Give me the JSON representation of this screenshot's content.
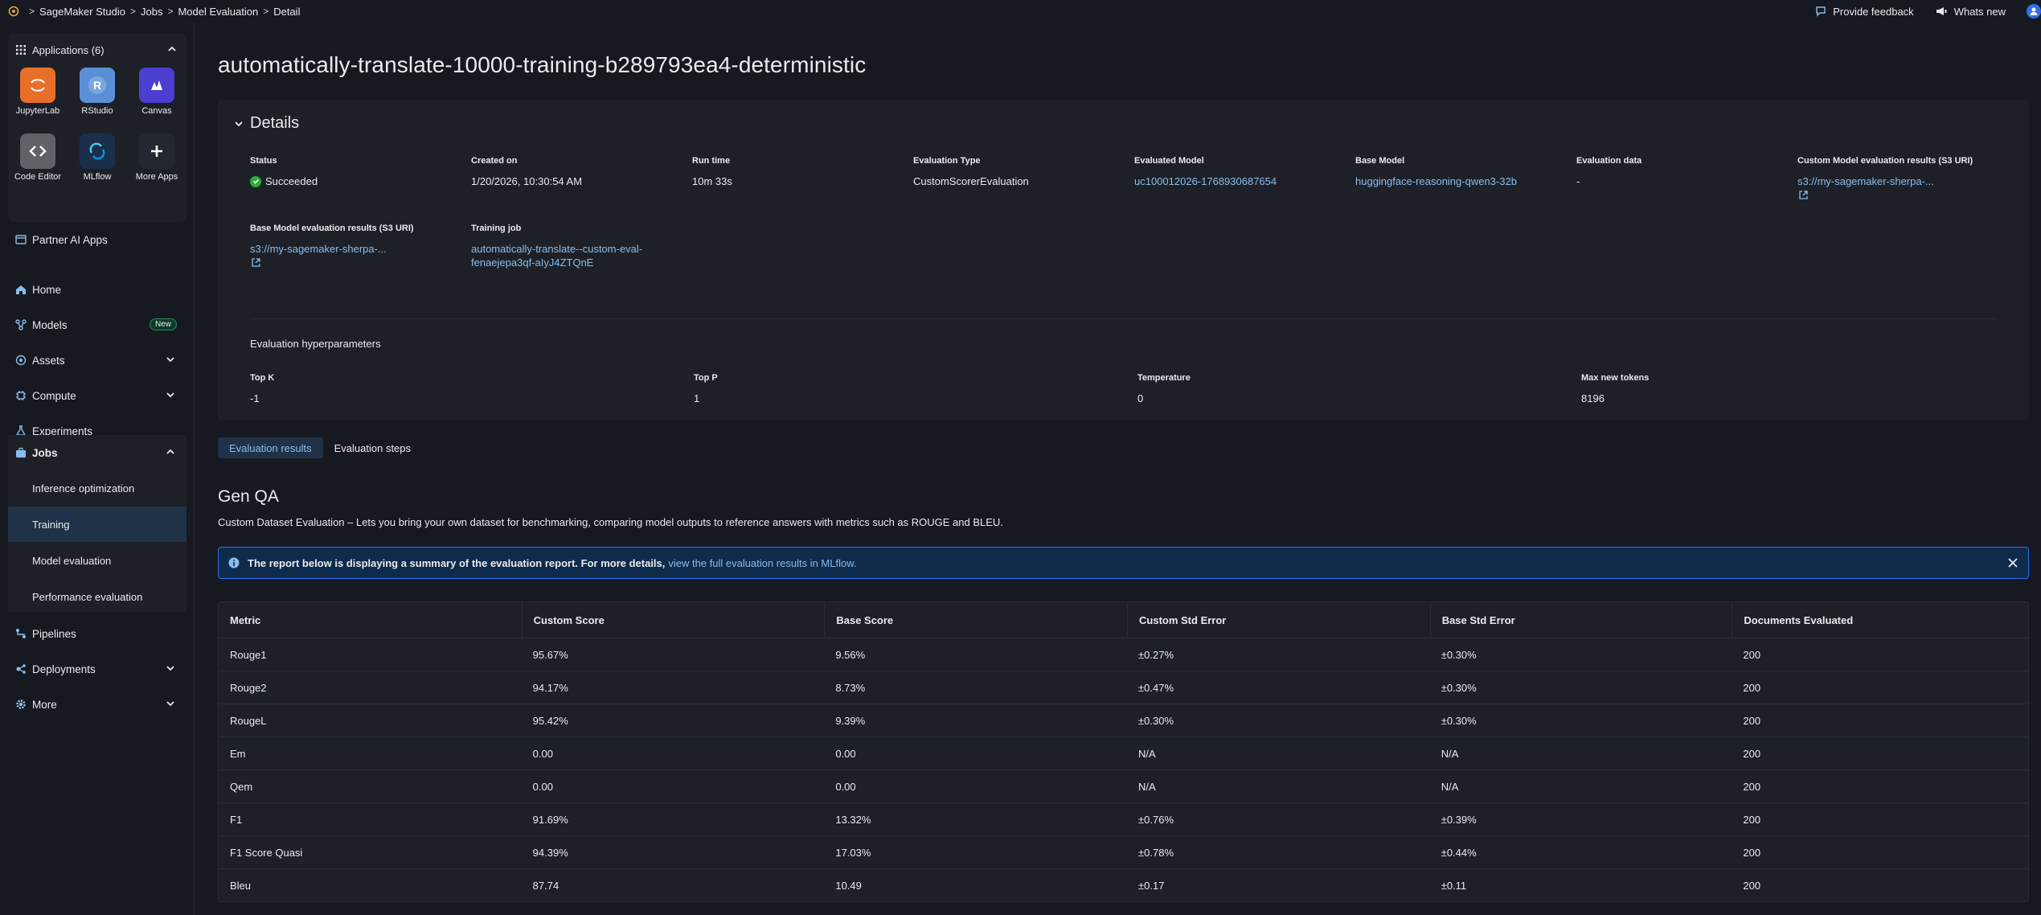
{
  "topbar": {
    "breadcrumbs": [
      "SageMaker Studio",
      "Jobs",
      "Model Evaluation",
      "Detail"
    ],
    "feedback_label": "Provide feedback",
    "whats_new_label": "Whats new"
  },
  "sidebar": {
    "apps_header": "Applications (6)",
    "apps": [
      {
        "label": "JupyterLab",
        "icon": "jupyterlab-icon",
        "color": "#e76f2a"
      },
      {
        "label": "RStudio",
        "icon": "rstudio-icon",
        "color": "#5a8fd6"
      },
      {
        "label": "Canvas",
        "icon": "canvas-icon",
        "color": "#4b3fd1"
      },
      {
        "label": "Code Editor",
        "icon": "code-editor-icon",
        "color": "#5f6368"
      },
      {
        "label": "MLflow",
        "icon": "mlflow-icon",
        "color": "#1a2f4a"
      },
      {
        "label": "More Apps",
        "icon": "plus-icon",
        "color": "#232830"
      }
    ],
    "partner": "Partner AI Apps",
    "nav": {
      "home": "Home",
      "models": "Models",
      "models_badge": "New",
      "assets": "Assets",
      "compute": "Compute",
      "experiments": "Experiments",
      "jobs": "Jobs",
      "jobs_sub": [
        "Inference optimization",
        "Training",
        "Model evaluation",
        "Performance evaluation"
      ],
      "pipelines": "Pipelines",
      "deployments": "Deployments",
      "more": "More"
    }
  },
  "page": {
    "title": "automatically-translate-10000-training-b289793ea4-deterministic"
  },
  "details": {
    "header": "Details",
    "fields": {
      "status_k": "Status",
      "status_v": "Succeeded",
      "created_k": "Created on",
      "created_v": "1/20/2026, 10:30:54 AM",
      "runtime_k": "Run time",
      "runtime_v": "10m 33s",
      "evaltype_k": "Evaluation Type",
      "evaltype_v": "CustomScorerEvaluation",
      "evalmodel_k": "Evaluated Model",
      "evalmodel_v": "uc100012026-1768930687654",
      "basemodel_k": "Base Model",
      "basemodel_v": "huggingface-reasoning-qwen3-32b",
      "evaldata_k": "Evaluation data",
      "evaldata_v": "-",
      "custom_s3_k": "Custom Model evaluation results (S3 URI)",
      "custom_s3_v": "s3://my-sagemaker-sherpa-...",
      "base_s3_k": "Base Model evaluation results (S3 URI)",
      "base_s3_v": "s3://my-sagemaker-sherpa-...",
      "training_k": "Training job",
      "training_v1": "automatically-translate--custom-eval-",
      "training_v2": "fenaejepa3qf-aIyJ4ZTQnE"
    },
    "hyper_title": "Evaluation hyperparameters",
    "hyper": {
      "topk_k": "Top K",
      "topk_v": "-1",
      "topp_k": "Top P",
      "topp_v": "1",
      "temp_k": "Temperature",
      "temp_v": "0",
      "maxtok_k": "Max new tokens",
      "maxtok_v": "8196"
    }
  },
  "tabs": [
    "Evaluation results",
    "Evaluation steps"
  ],
  "section": {
    "title": "Gen QA",
    "desc": "Custom Dataset Evaluation – Lets you bring your own dataset for benchmarking, comparing model outputs to reference answers with metrics such as ROUGE and BLEU."
  },
  "alert": {
    "text": "The report below is displaying a summary of the evaluation report. For more details,",
    "link": "view the full evaluation results in MLflow."
  },
  "table": {
    "headers": [
      "Metric",
      "Custom Score",
      "Base Score",
      "Custom Std Error",
      "Base Std Error",
      "Documents Evaluated"
    ],
    "rows": [
      [
        "Rouge1",
        "95.67%",
        "9.56%",
        "±0.27%",
        "±0.30%",
        "200"
      ],
      [
        "Rouge2",
        "94.17%",
        "8.73%",
        "±0.47%",
        "±0.30%",
        "200"
      ],
      [
        "RougeL",
        "95.42%",
        "9.39%",
        "±0.30%",
        "±0.30%",
        "200"
      ],
      [
        "Em",
        "0.00",
        "0.00",
        "N/A",
        "N/A",
        "200"
      ],
      [
        "Qem",
        "0.00",
        "0.00",
        "N/A",
        "N/A",
        "200"
      ],
      [
        "F1",
        "91.69%",
        "13.32%",
        "±0.76%",
        "±0.39%",
        "200"
      ],
      [
        "F1 Score Quasi",
        "94.39%",
        "17.03%",
        "±0.78%",
        "±0.44%",
        "200"
      ],
      [
        "Bleu",
        "87.74",
        "10.49",
        "±0.17",
        "±0.11",
        "200"
      ]
    ]
  }
}
